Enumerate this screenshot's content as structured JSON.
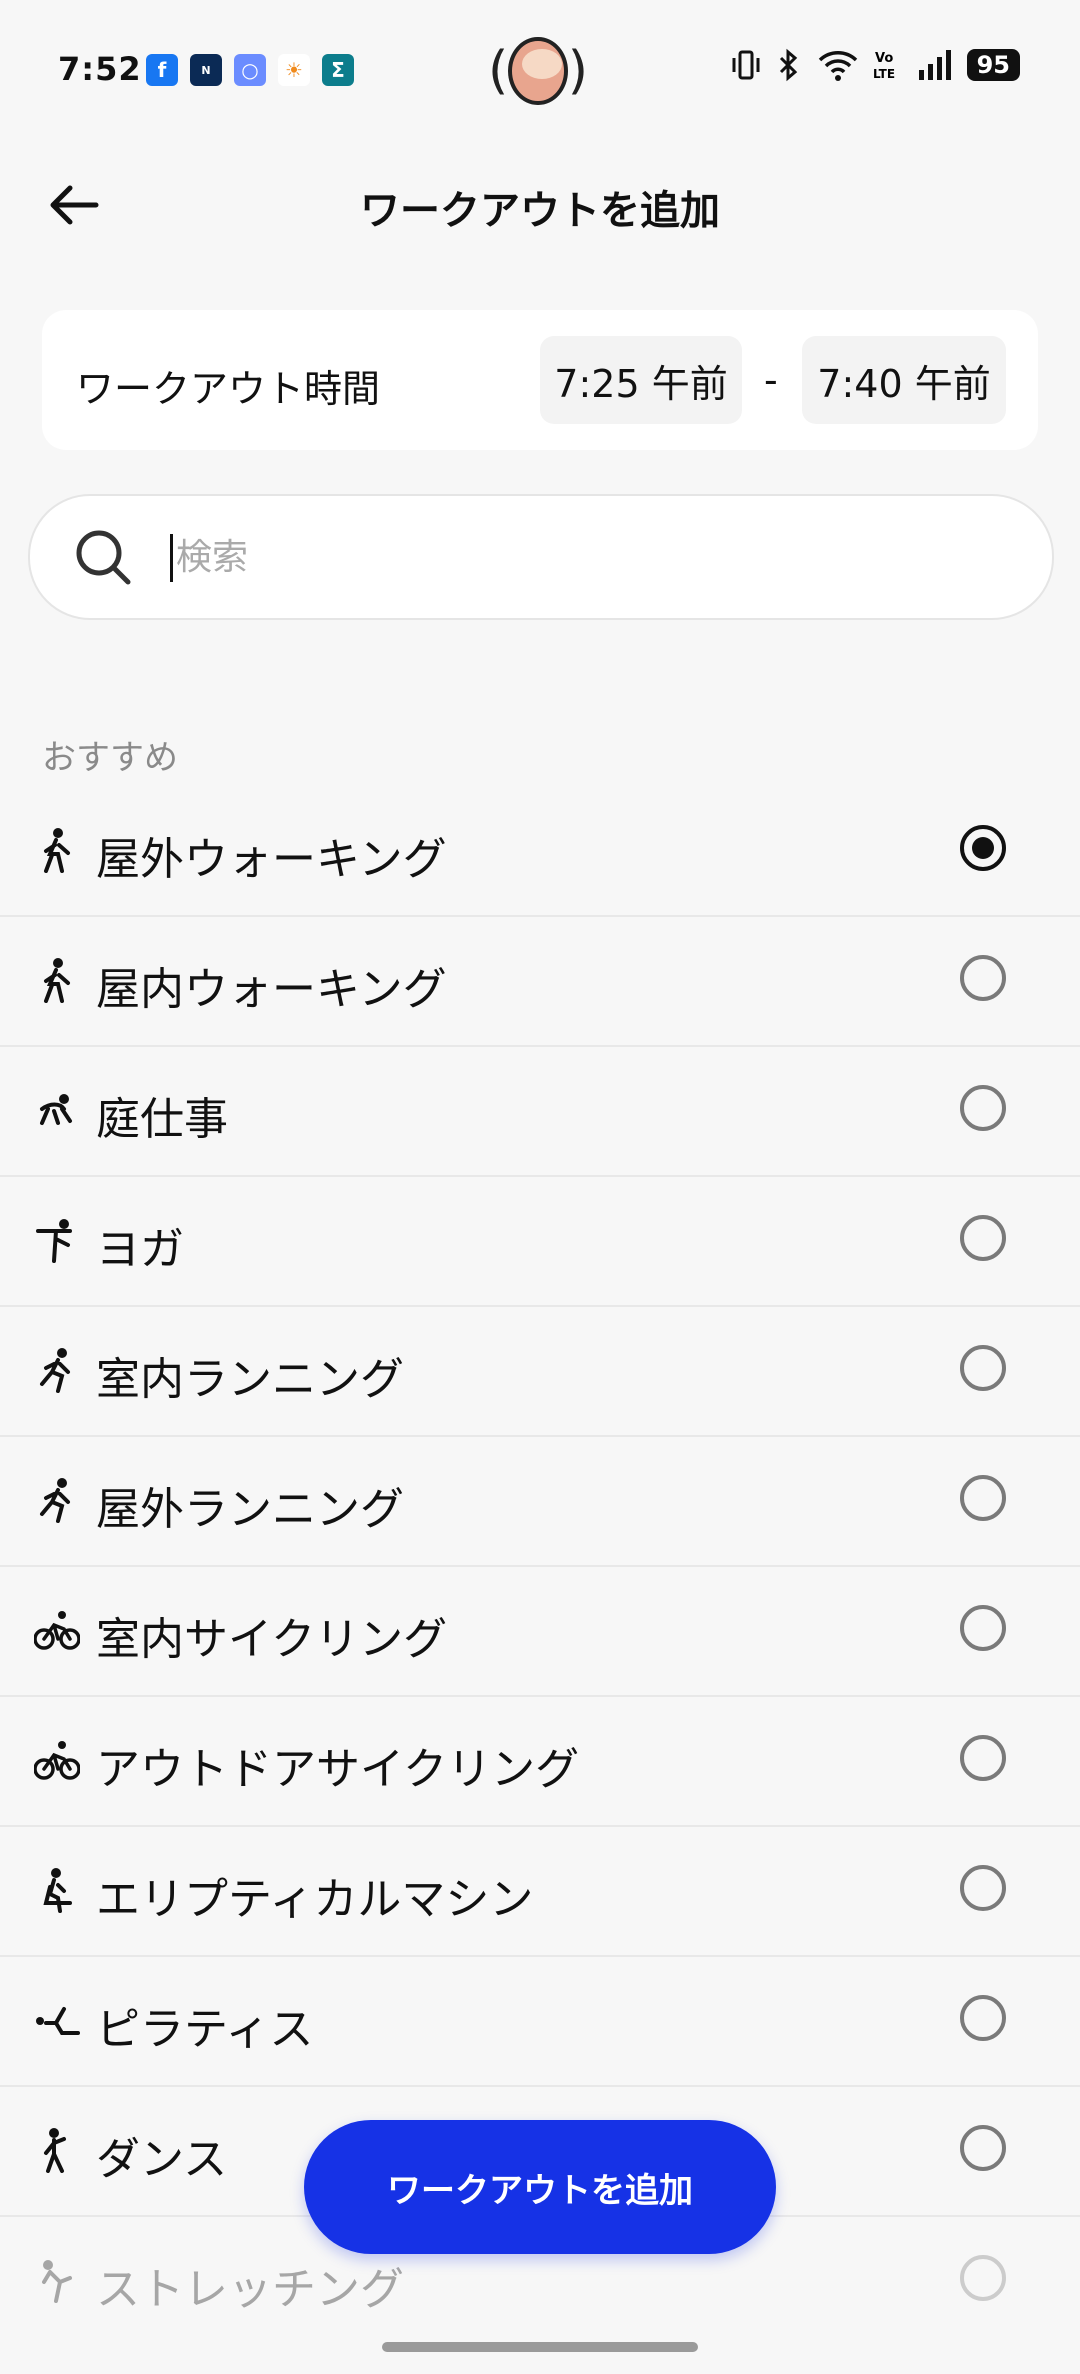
{
  "status_bar": {
    "time": "7:52",
    "battery": "95",
    "apps": [
      {
        "icon": "facebook-icon",
        "color": "#1877f2",
        "glyph": "f"
      },
      {
        "icon": "nikkei-icon",
        "color": "#0b2a55",
        "glyph": "N"
      },
      {
        "icon": "app-ring-icon",
        "color": "#6b8cff",
        "glyph": "○"
      },
      {
        "icon": "weather-icon",
        "color": "#ffffff",
        "glyph": "☀"
      },
      {
        "icon": "sigma-icon",
        "color": "#0c7d8c",
        "glyph": "Σ"
      }
    ]
  },
  "header": {
    "title": "ワークアウトを追加"
  },
  "time_card": {
    "label": "ワークアウト時間",
    "start": "7:25 午前",
    "separator": "-",
    "end": "7:40 午前"
  },
  "search": {
    "placeholder": "検索",
    "value": ""
  },
  "section_label": "おすすめ",
  "workouts": [
    {
      "label": "屋外ウォーキング",
      "icon": "walking-icon",
      "selected": true
    },
    {
      "label": "屋内ウォーキング",
      "icon": "walking-icon",
      "selected": false
    },
    {
      "label": "庭仕事",
      "icon": "gardening-icon",
      "selected": false
    },
    {
      "label": "ヨガ",
      "icon": "yoga-icon",
      "selected": false
    },
    {
      "label": "室内ランニング",
      "icon": "running-icon",
      "selected": false
    },
    {
      "label": "屋外ランニング",
      "icon": "running-icon",
      "selected": false
    },
    {
      "label": "室内サイクリング",
      "icon": "cycling-icon",
      "selected": false
    },
    {
      "label": "アウトドアサイクリング",
      "icon": "cycling-icon",
      "selected": false
    },
    {
      "label": "エリプティカルマシン",
      "icon": "elliptical-icon",
      "selected": false
    },
    {
      "label": "ピラティス",
      "icon": "pilates-icon",
      "selected": false
    },
    {
      "label": "ダンス",
      "icon": "dance-icon",
      "selected": false
    },
    {
      "label": "ストレッチング",
      "icon": "stretching-icon",
      "selected": false
    }
  ],
  "add_button": "ワークアウトを追加"
}
